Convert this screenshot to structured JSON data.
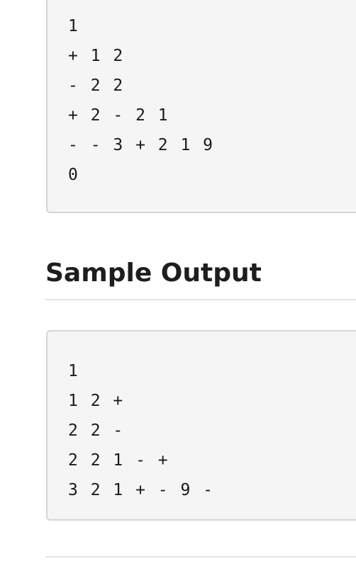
{
  "sample_input": {
    "lines": [
      "1",
      "+ 1 2",
      "- 2 2",
      "+ 2 - 2 1",
      "- - 3 + 2 1 9",
      "0"
    ]
  },
  "sample_output": {
    "heading": "Sample Output",
    "lines": [
      "1",
      "1 2 +",
      "2 2 -",
      "2 2 1 - +",
      "3 2 1 + - 9 -"
    ]
  }
}
